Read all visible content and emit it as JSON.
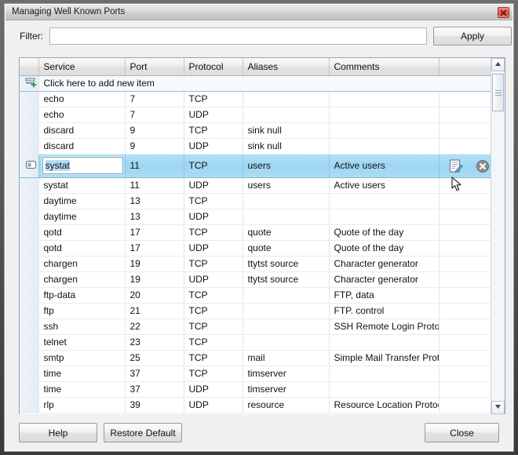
{
  "window": {
    "title": "Managing Well Known Ports",
    "close_icon": "close-x-icon"
  },
  "filter": {
    "label": "Filter:",
    "value": "",
    "placeholder": "",
    "apply_label": "Apply"
  },
  "grid": {
    "columns": [
      "Service",
      "Port",
      "Protocol",
      "Aliases",
      "Comments",
      ""
    ],
    "new_item_text": "Click here to add new item",
    "new_item_icon": "add-new-row-icon",
    "selected_row_indicator_icon": "row-edit-pencil-icon",
    "edit_icon": "edit-row-icon",
    "delete_icon": "delete-row-icon",
    "editor": {
      "value": "systat",
      "selected": true
    },
    "rows": [
      {
        "service": "echo",
        "port": "7",
        "protocol": "TCP",
        "aliases": "",
        "comments": ""
      },
      {
        "service": "echo",
        "port": "7",
        "protocol": "UDP",
        "aliases": "",
        "comments": ""
      },
      {
        "service": "discard",
        "port": "9",
        "protocol": "TCP",
        "aliases": "sink null",
        "comments": ""
      },
      {
        "service": "discard",
        "port": "9",
        "protocol": "UDP",
        "aliases": "sink null",
        "comments": ""
      },
      {
        "service": "systat",
        "port": "11",
        "protocol": "TCP",
        "aliases": "users",
        "comments": "Active users",
        "selected": true
      },
      {
        "service": "systat",
        "port": "11",
        "protocol": "UDP",
        "aliases": "users",
        "comments": "Active users"
      },
      {
        "service": "daytime",
        "port": "13",
        "protocol": "TCP",
        "aliases": "",
        "comments": ""
      },
      {
        "service": "daytime",
        "port": "13",
        "protocol": "UDP",
        "aliases": "",
        "comments": ""
      },
      {
        "service": "qotd",
        "port": "17",
        "protocol": "TCP",
        "aliases": "quote",
        "comments": "Quote of the day"
      },
      {
        "service": "qotd",
        "port": "17",
        "protocol": "UDP",
        "aliases": "quote",
        "comments": "Quote of the day"
      },
      {
        "service": "chargen",
        "port": "19",
        "protocol": "TCP",
        "aliases": "ttytst source",
        "comments": "Character generator"
      },
      {
        "service": "chargen",
        "port": "19",
        "protocol": "UDP",
        "aliases": "ttytst source",
        "comments": "Character generator"
      },
      {
        "service": "ftp-data",
        "port": "20",
        "protocol": "TCP",
        "aliases": "",
        "comments": "FTP, data"
      },
      {
        "service": "ftp",
        "port": "21",
        "protocol": "TCP",
        "aliases": "",
        "comments": "FTP. control"
      },
      {
        "service": "ssh",
        "port": "22",
        "protocol": "TCP",
        "aliases": "",
        "comments": "SSH Remote Login Protocol"
      },
      {
        "service": "telnet",
        "port": "23",
        "protocol": "TCP",
        "aliases": "",
        "comments": ""
      },
      {
        "service": "smtp",
        "port": "25",
        "protocol": "TCP",
        "aliases": "mail",
        "comments": "Simple Mail Transfer Protocol"
      },
      {
        "service": "time",
        "port": "37",
        "protocol": "TCP",
        "aliases": "timserver",
        "comments": ""
      },
      {
        "service": "time",
        "port": "37",
        "protocol": "UDP",
        "aliases": "timserver",
        "comments": ""
      },
      {
        "service": "rlp",
        "port": "39",
        "protocol": "UDP",
        "aliases": "resource",
        "comments": "Resource Location Protocol"
      }
    ],
    "scrollbar": {
      "up_icon": "scroll-up-arrow-icon",
      "down_icon": "scroll-down-arrow-icon"
    }
  },
  "footer": {
    "help_label": "Help",
    "restore_label": "Restore Default",
    "close_label": "Close"
  },
  "cursor": {
    "icon": "mouse-pointer-icon"
  },
  "colors": {
    "selection_blue": "#9ed6f2",
    "grid_border": "#8ba7c4",
    "close_red": "#e04b36",
    "dialog_bg": "#f0f0f0"
  }
}
